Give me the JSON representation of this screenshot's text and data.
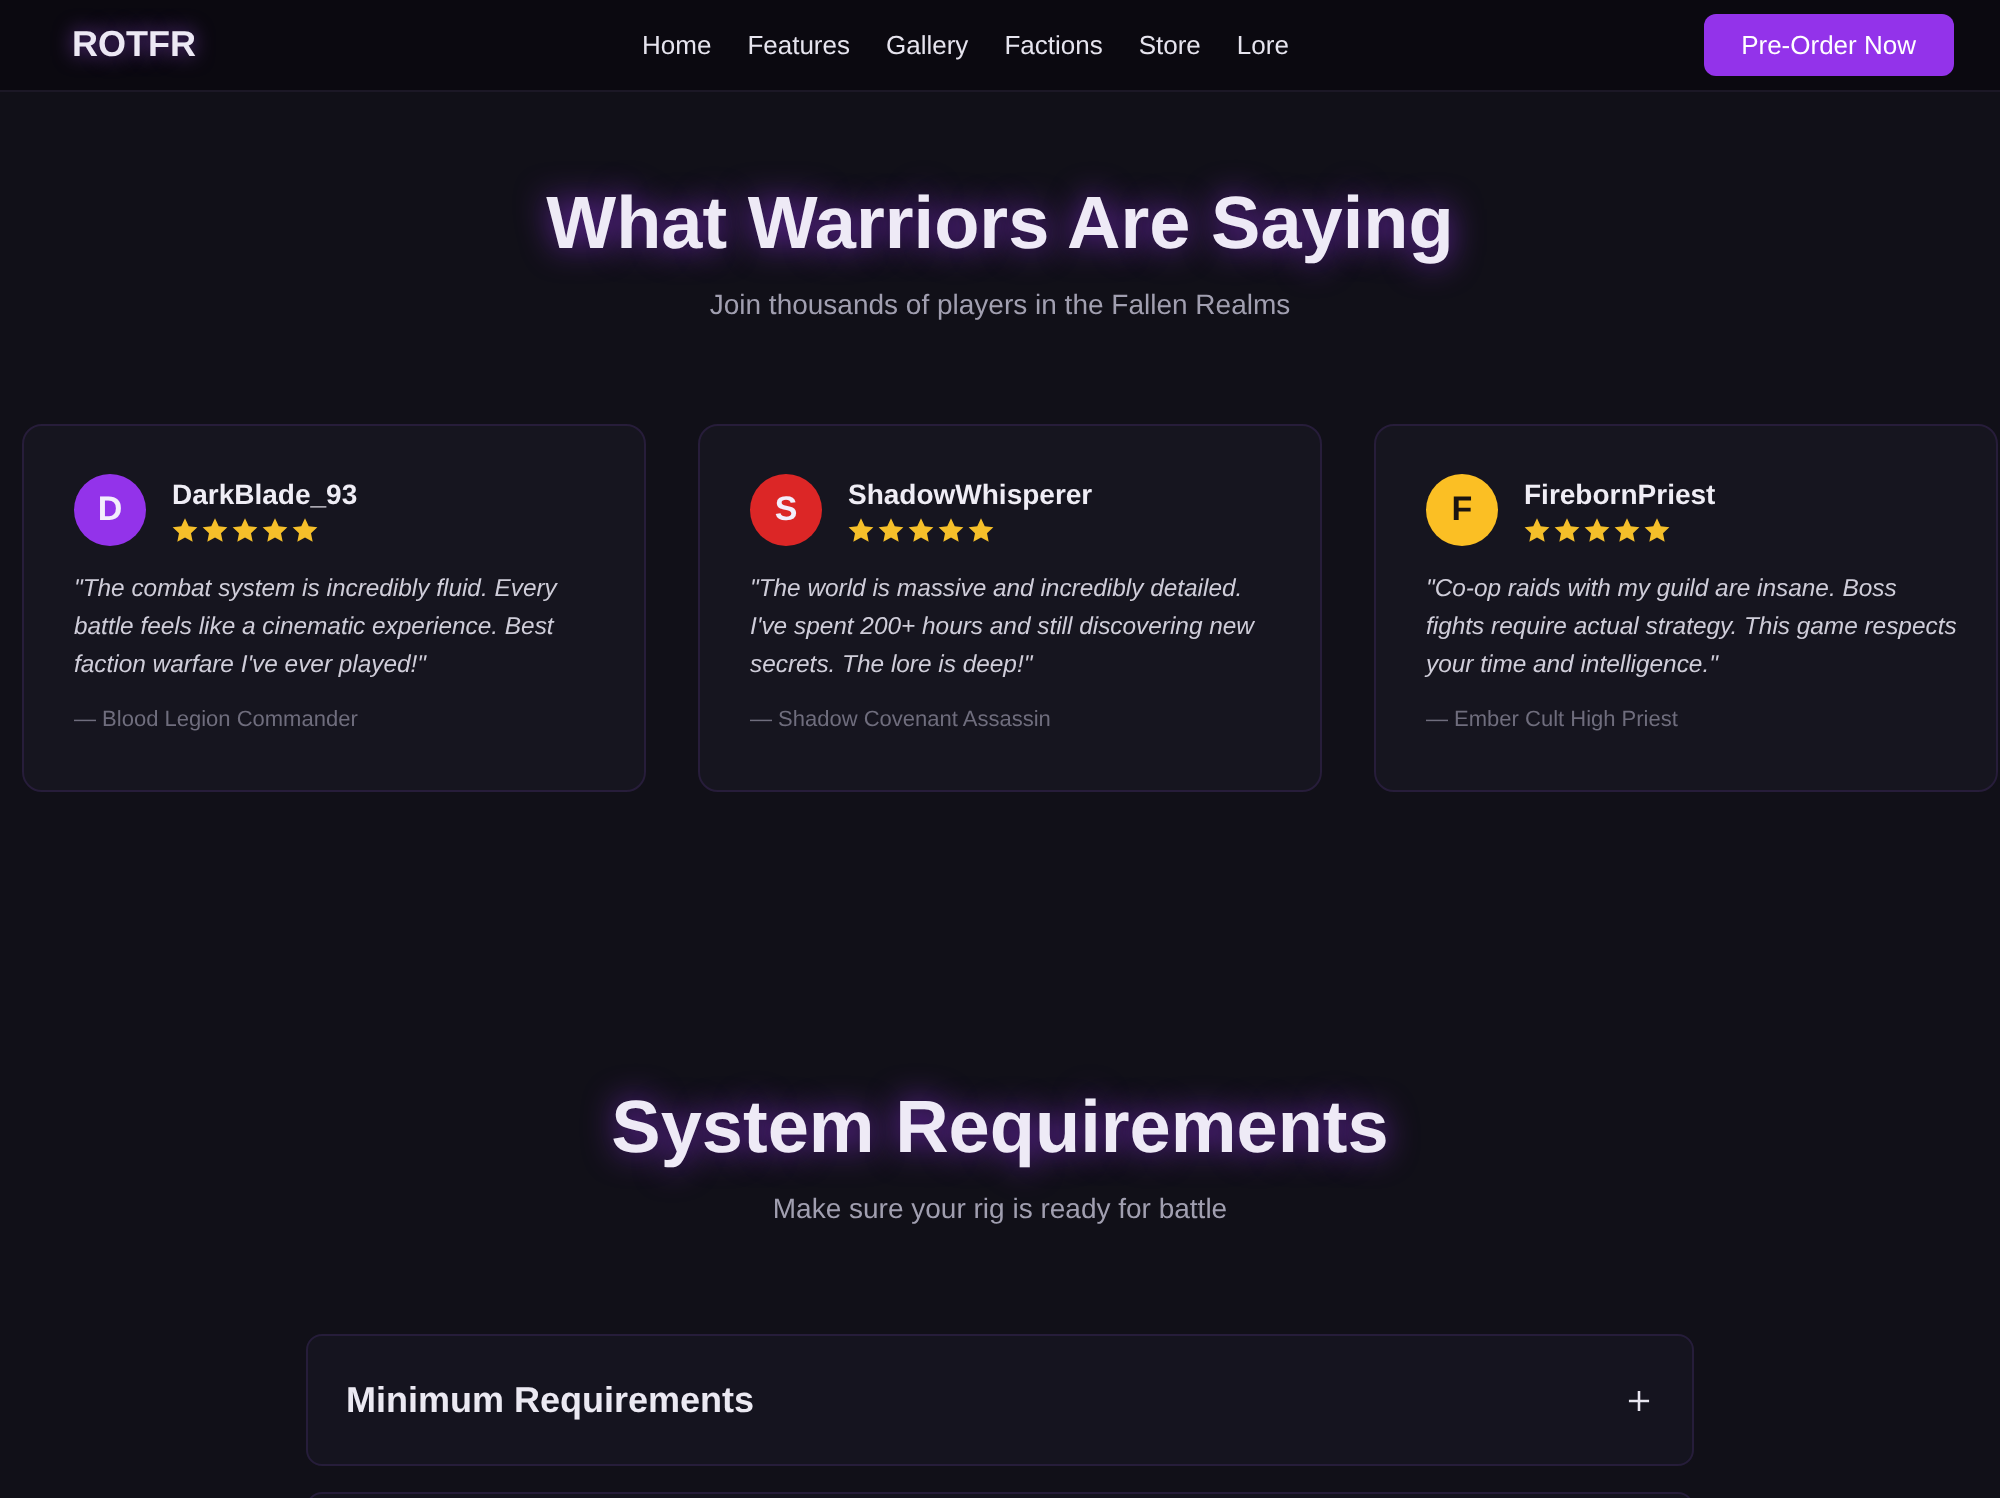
{
  "nav": {
    "logo": "ROTFR",
    "links": [
      "Home",
      "Features",
      "Gallery",
      "Factions",
      "Store",
      "Lore"
    ],
    "cta": "Pre-Order Now"
  },
  "testimonials": {
    "title": "What Warriors Are Saying",
    "subtitle": "Join thousands of players in the Fallen Realms",
    "items": [
      {
        "initial": "D",
        "color": "#9333ea",
        "name": "DarkBlade_93",
        "stars": 5,
        "quote": "\"The combat system is incredibly fluid. Every battle feels like a cinematic experience. Best faction warfare I've ever played!\"",
        "attribution": "— Blood Legion Commander"
      },
      {
        "initial": "S",
        "color": "#dc2626",
        "name": "ShadowWhisperer",
        "stars": 5,
        "quote": "\"The world is massive and incredibly detailed. I've spent 200+ hours and still discovering new secrets. The lore is deep!\"",
        "attribution": "— Shadow Covenant Assassin"
      },
      {
        "initial": "F",
        "color": "#fbbf24",
        "name": "FirebornPriest",
        "stars": 5,
        "quote": "\"Co-op raids with my guild are insane. Boss fights require actual strategy. This game respects your time and intelligence.\"",
        "attribution": "— Ember Cult High Priest"
      }
    ]
  },
  "requirements": {
    "title": "System Requirements",
    "subtitle": "Make sure your rig is ready for battle",
    "sections": [
      {
        "title": "Minimum Requirements",
        "expanded": false
      }
    ]
  }
}
